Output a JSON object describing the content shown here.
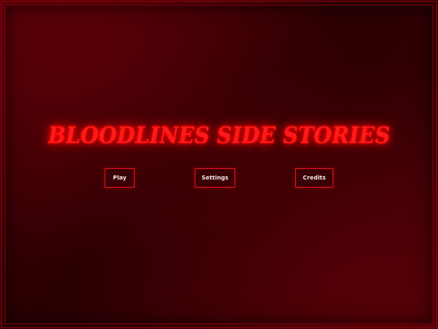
{
  "game": {
    "title": "BLOODLINES SIDE STORIES"
  },
  "menu": {
    "play_label": "Play",
    "settings_label": "Settings",
    "credits_label": "Credits"
  },
  "colors": {
    "accent": "#ff1a1a",
    "border": "#e0101a",
    "background": "#2a0003"
  }
}
